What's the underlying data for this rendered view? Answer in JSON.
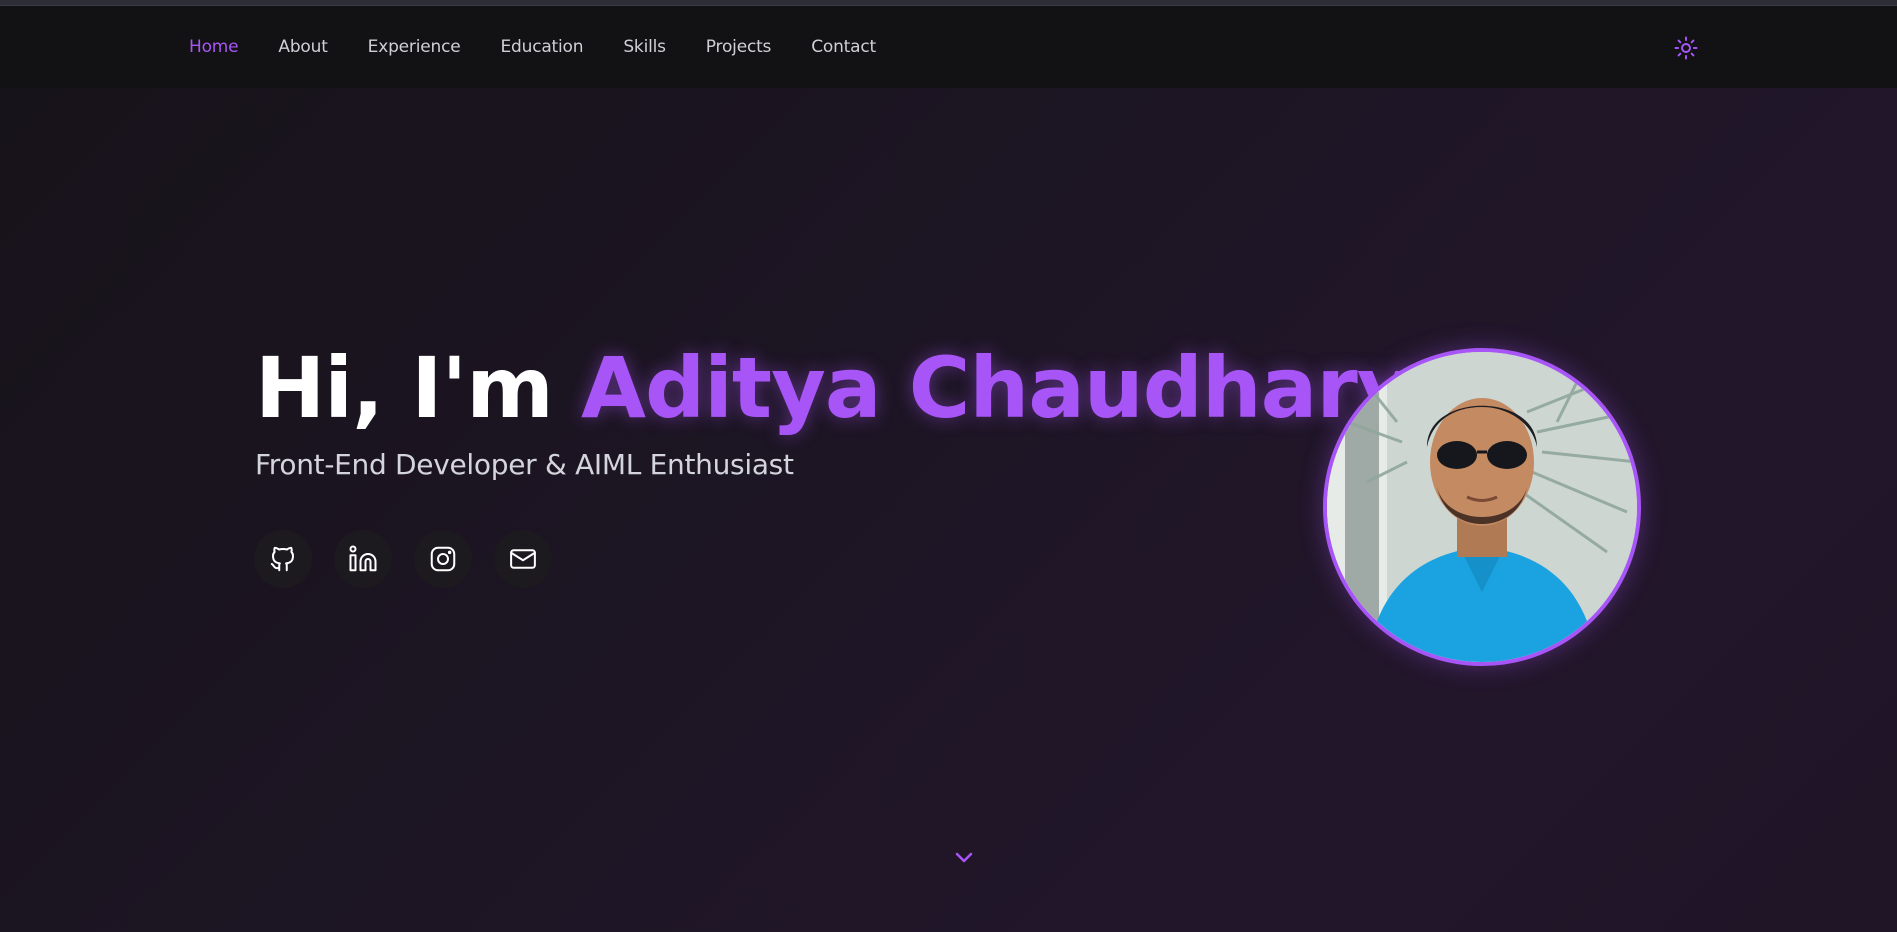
{
  "nav": {
    "items": [
      {
        "label": "Home",
        "active": true
      },
      {
        "label": "About",
        "active": false
      },
      {
        "label": "Experience",
        "active": false
      },
      {
        "label": "Education",
        "active": false
      },
      {
        "label": "Skills",
        "active": false
      },
      {
        "label": "Projects",
        "active": false
      },
      {
        "label": "Contact",
        "active": false
      }
    ],
    "theme_icon": "sun-icon"
  },
  "hero": {
    "greeting": "Hi, I'm",
    "name": "Aditya Chaudhary",
    "subtitle": "Front-End Developer & AIML Enthusiast",
    "socials": [
      {
        "icon": "github-icon"
      },
      {
        "icon": "linkedin-icon"
      },
      {
        "icon": "instagram-icon"
      },
      {
        "icon": "mail-icon"
      }
    ],
    "scroll_icon": "chevron-down-icon"
  },
  "colors": {
    "accent": "#a855f7",
    "navbar_bg": "#121214",
    "hero_bg": "#1d1524",
    "text": "#ffffff",
    "muted_text": "#d4d4dc"
  }
}
